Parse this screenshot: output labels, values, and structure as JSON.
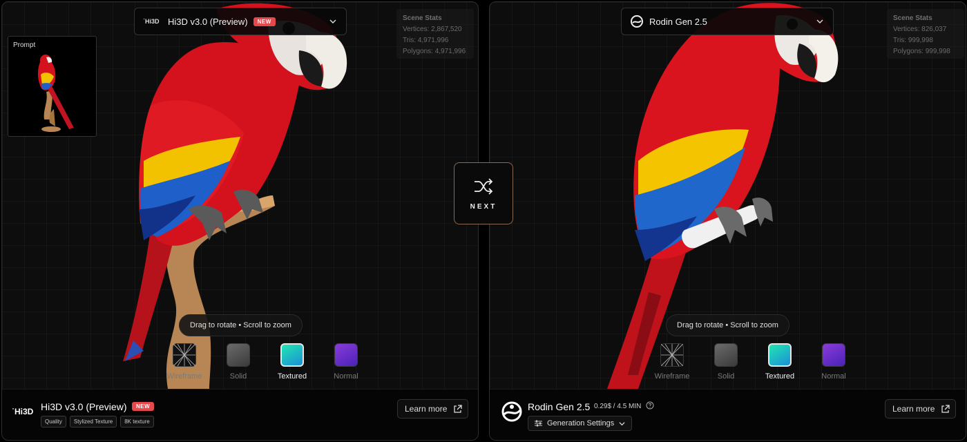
{
  "left": {
    "selector": {
      "logo": "˙Hi3D",
      "title": "Hi3D v3.0 (Preview)",
      "badge": "NEW"
    },
    "stats": {
      "heading": "Scene Stats",
      "vertices": "Vertices: 2,867,520",
      "tris": "Tris: 4,971,996",
      "polygons": "Polygons: 4,971,996"
    },
    "prompt_label": "Prompt",
    "hint": "Drag to rotate • Scroll to zoom",
    "modes": [
      "Wireframe",
      "Solid",
      "Textured",
      "Normal"
    ],
    "footer": {
      "logo": "˙Hi3D",
      "name": "Hi3D v3.0 (Preview)",
      "badge": "NEW",
      "tags": [
        "Quality",
        "Stylized Texture",
        "8K texture"
      ],
      "learn_more": "Learn more"
    }
  },
  "right": {
    "selector": {
      "title": "Rodin Gen 2.5"
    },
    "stats": {
      "heading": "Scene Stats",
      "vertices": "Vertices: 826,037",
      "tris": "Tris: 999,998",
      "polygons": "Polygons: 999,998"
    },
    "hint": "Drag to rotate • Scroll to zoom",
    "modes": [
      "Wireframe",
      "Solid",
      "Textured",
      "Normal"
    ],
    "footer": {
      "name": "Rodin Gen 2.5",
      "price": "0.29$ / 4.5 MIN",
      "settings": "Generation Settings",
      "learn_more": "Learn more"
    }
  },
  "next_label": "NEXT",
  "active_mode": "Textured",
  "colors": {
    "new_badge": "#e5484d",
    "next_border": "#8a6a52",
    "textured": "#21e6b0",
    "normal": "#6a2fd0"
  }
}
